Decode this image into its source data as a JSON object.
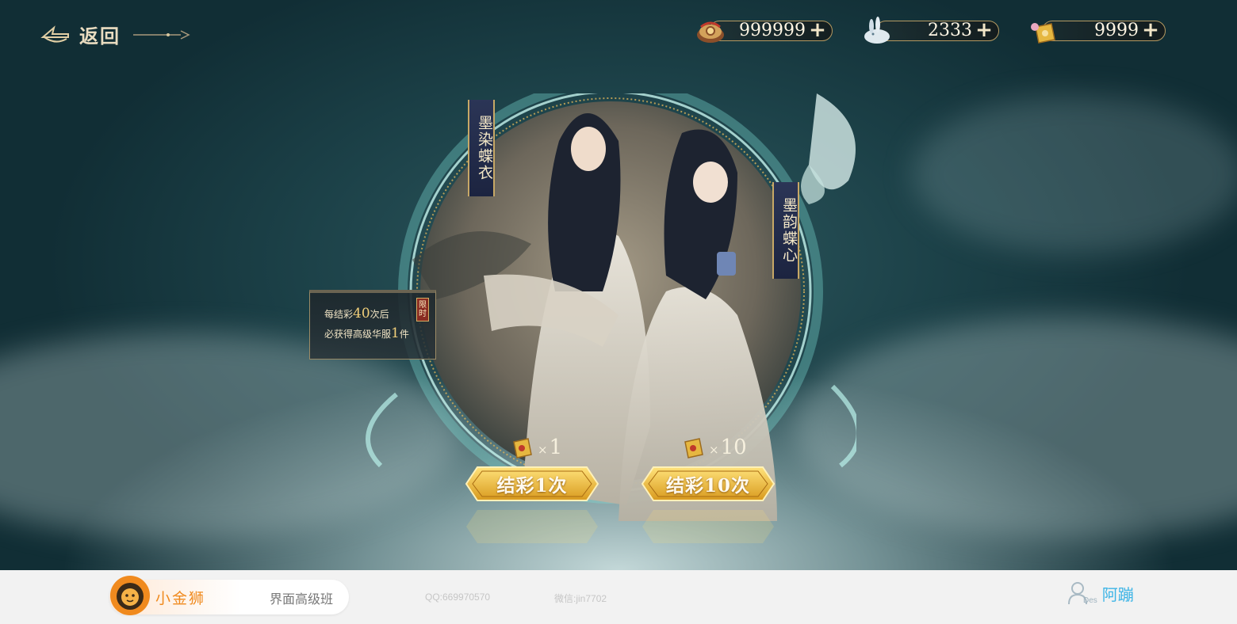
{
  "nav": {
    "back_label": "返回"
  },
  "currencies": [
    {
      "icon": "coin-bag-icon",
      "value": "999999"
    },
    {
      "icon": "jade-rabbit-icon",
      "value": "2333"
    },
    {
      "icon": "golden-pouch-icon",
      "value": "9999"
    }
  ],
  "hero": {
    "scroll_left": "墨染蝶衣",
    "scroll_right": "墨韵蝶心"
  },
  "guarantee": {
    "line1_pre": "每结彩",
    "line1_num": "40",
    "line1_post": "次后",
    "line2_pre": "必获得高级华服",
    "line2_num": "1",
    "line2_post": "件",
    "tag": "限时"
  },
  "draws": [
    {
      "cost_multiplier": "×",
      "cost": "1",
      "label": "结彩1次"
    },
    {
      "cost_multiplier": "×",
      "cost": "10",
      "label": "结彩10次"
    }
  ],
  "footer": {
    "brand": "小金狮",
    "course": "界面高级班",
    "qq": "QQ:669970570",
    "wechat": "微信:jin7702",
    "author_tag": "Des",
    "author": "阿蹦"
  },
  "colors": {
    "gold": "#e7b43a",
    "accent_teal": "#7fe0d8",
    "brand_orange": "#f08a1e",
    "author_blue": "#3cb4e6"
  }
}
